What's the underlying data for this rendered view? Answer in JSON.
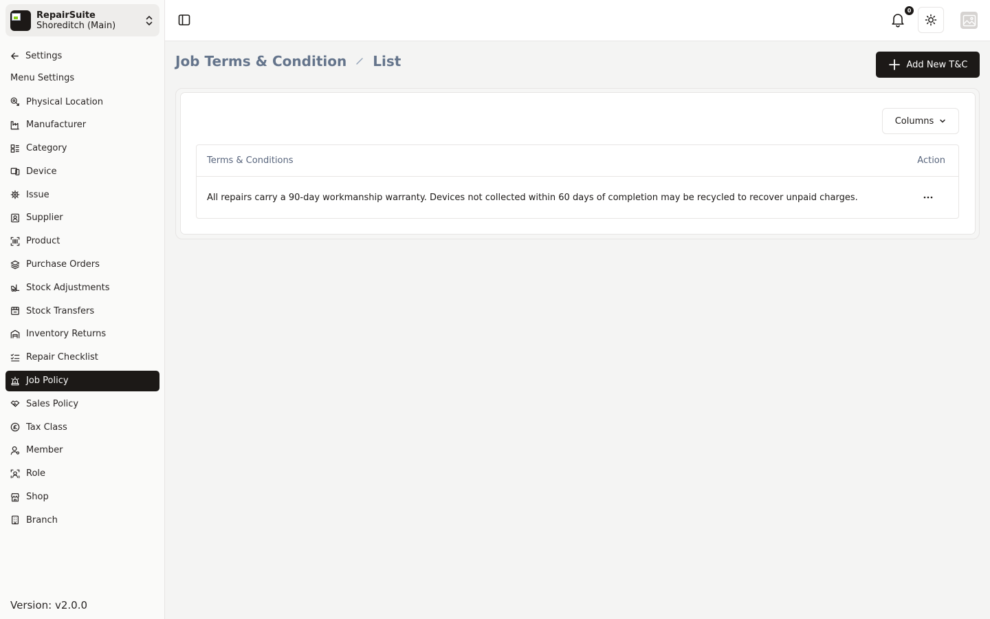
{
  "workspace": {
    "name": "RepairSuite",
    "branch": "Shoreditch (Main)"
  },
  "sidebar": {
    "back_label": "Settings",
    "heading": "Menu Settings",
    "items": [
      {
        "label": "Physical Location",
        "icon": "location-pin-icon"
      },
      {
        "label": "Manufacturer",
        "icon": "factory-icon"
      },
      {
        "label": "Category",
        "icon": "category-icon"
      },
      {
        "label": "Device",
        "icon": "devices-icon"
      },
      {
        "label": "Issue",
        "icon": "bug-icon"
      },
      {
        "label": "Supplier",
        "icon": "supplier-icon"
      },
      {
        "label": "Product",
        "icon": "barcode-icon"
      },
      {
        "label": "Purchase Orders",
        "icon": "layers-icon"
      },
      {
        "label": "Stock Adjustments",
        "icon": "forklift-icon"
      },
      {
        "label": "Stock Transfers",
        "icon": "package-icon"
      },
      {
        "label": "Inventory Returns",
        "icon": "warehouse-icon"
      },
      {
        "label": "Repair Checklist",
        "icon": "checklist-icon"
      },
      {
        "label": "Job Policy",
        "icon": "siren-icon",
        "active": true
      },
      {
        "label": "Sales Policy",
        "icon": "handshake-icon"
      },
      {
        "label": "Tax Class",
        "icon": "currency-icon"
      },
      {
        "label": "Member",
        "icon": "user-icon"
      },
      {
        "label": "Role",
        "icon": "role-icon"
      },
      {
        "label": "Shop",
        "icon": "store-icon"
      },
      {
        "label": "Branch",
        "icon": "building-icon"
      }
    ],
    "version": "Version: v2.0.0"
  },
  "topbar": {
    "notification_count": "0"
  },
  "page": {
    "breadcrumb": [
      "Job Terms & Condition",
      "List"
    ],
    "add_button_label": "Add New T&C",
    "columns_button_label": "Columns"
  },
  "table": {
    "headers": [
      "Terms & Conditions",
      "Action"
    ],
    "rows": [
      {
        "text": "All repairs carry a 90-day workmanship warranty. Devices not collected within 60 days of completion may be recycled to recover unpaid charges."
      }
    ]
  },
  "colors": {
    "accent": "#1c1917",
    "breadcrumb": "#64748b",
    "background": "#f4f4f3"
  }
}
